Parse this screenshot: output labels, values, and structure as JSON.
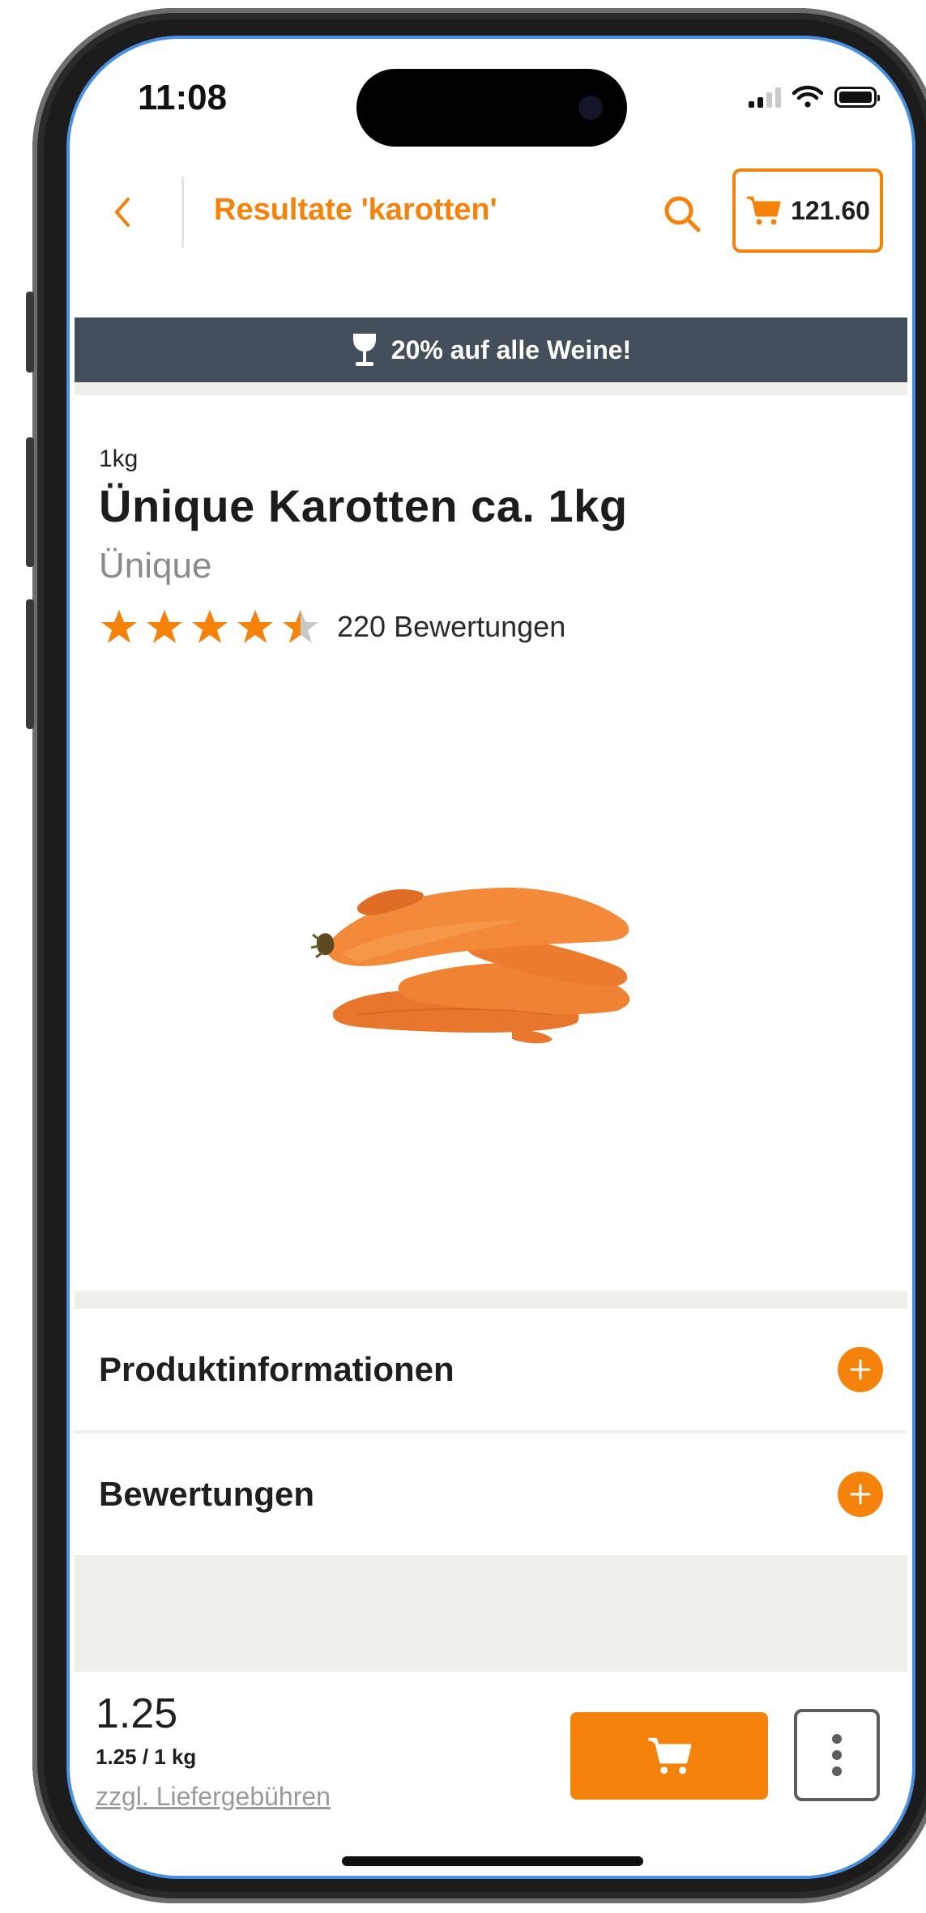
{
  "status_bar": {
    "time": "11:08"
  },
  "header": {
    "title": "Resultate 'karotten'",
    "cart_total": "121.60"
  },
  "promo": {
    "text": "20% auf alle Weine!"
  },
  "product": {
    "size": "1kg",
    "title": "Ünique Karotten ca. 1kg",
    "brand": "Ünique",
    "rating": 4.5,
    "rating_max": 5,
    "review_count_text": "220 Bewertungen"
  },
  "sections": [
    {
      "label": "Produktinformationen"
    },
    {
      "label": "Bewertungen"
    }
  ],
  "purchase": {
    "price": "1.25",
    "unit_price": "1.25 / 1 kg",
    "delivery_note": "zzgl. Liefergebühren"
  },
  "colors": {
    "accent": "#f5820a",
    "promo_bg": "#434f5b",
    "star_empty": "#c8c8c8"
  },
  "icons": [
    "back-chevron-icon",
    "search-icon",
    "cart-icon",
    "wine-glass-icon",
    "star-icon",
    "plus-icon",
    "more-vertical-icon"
  ]
}
